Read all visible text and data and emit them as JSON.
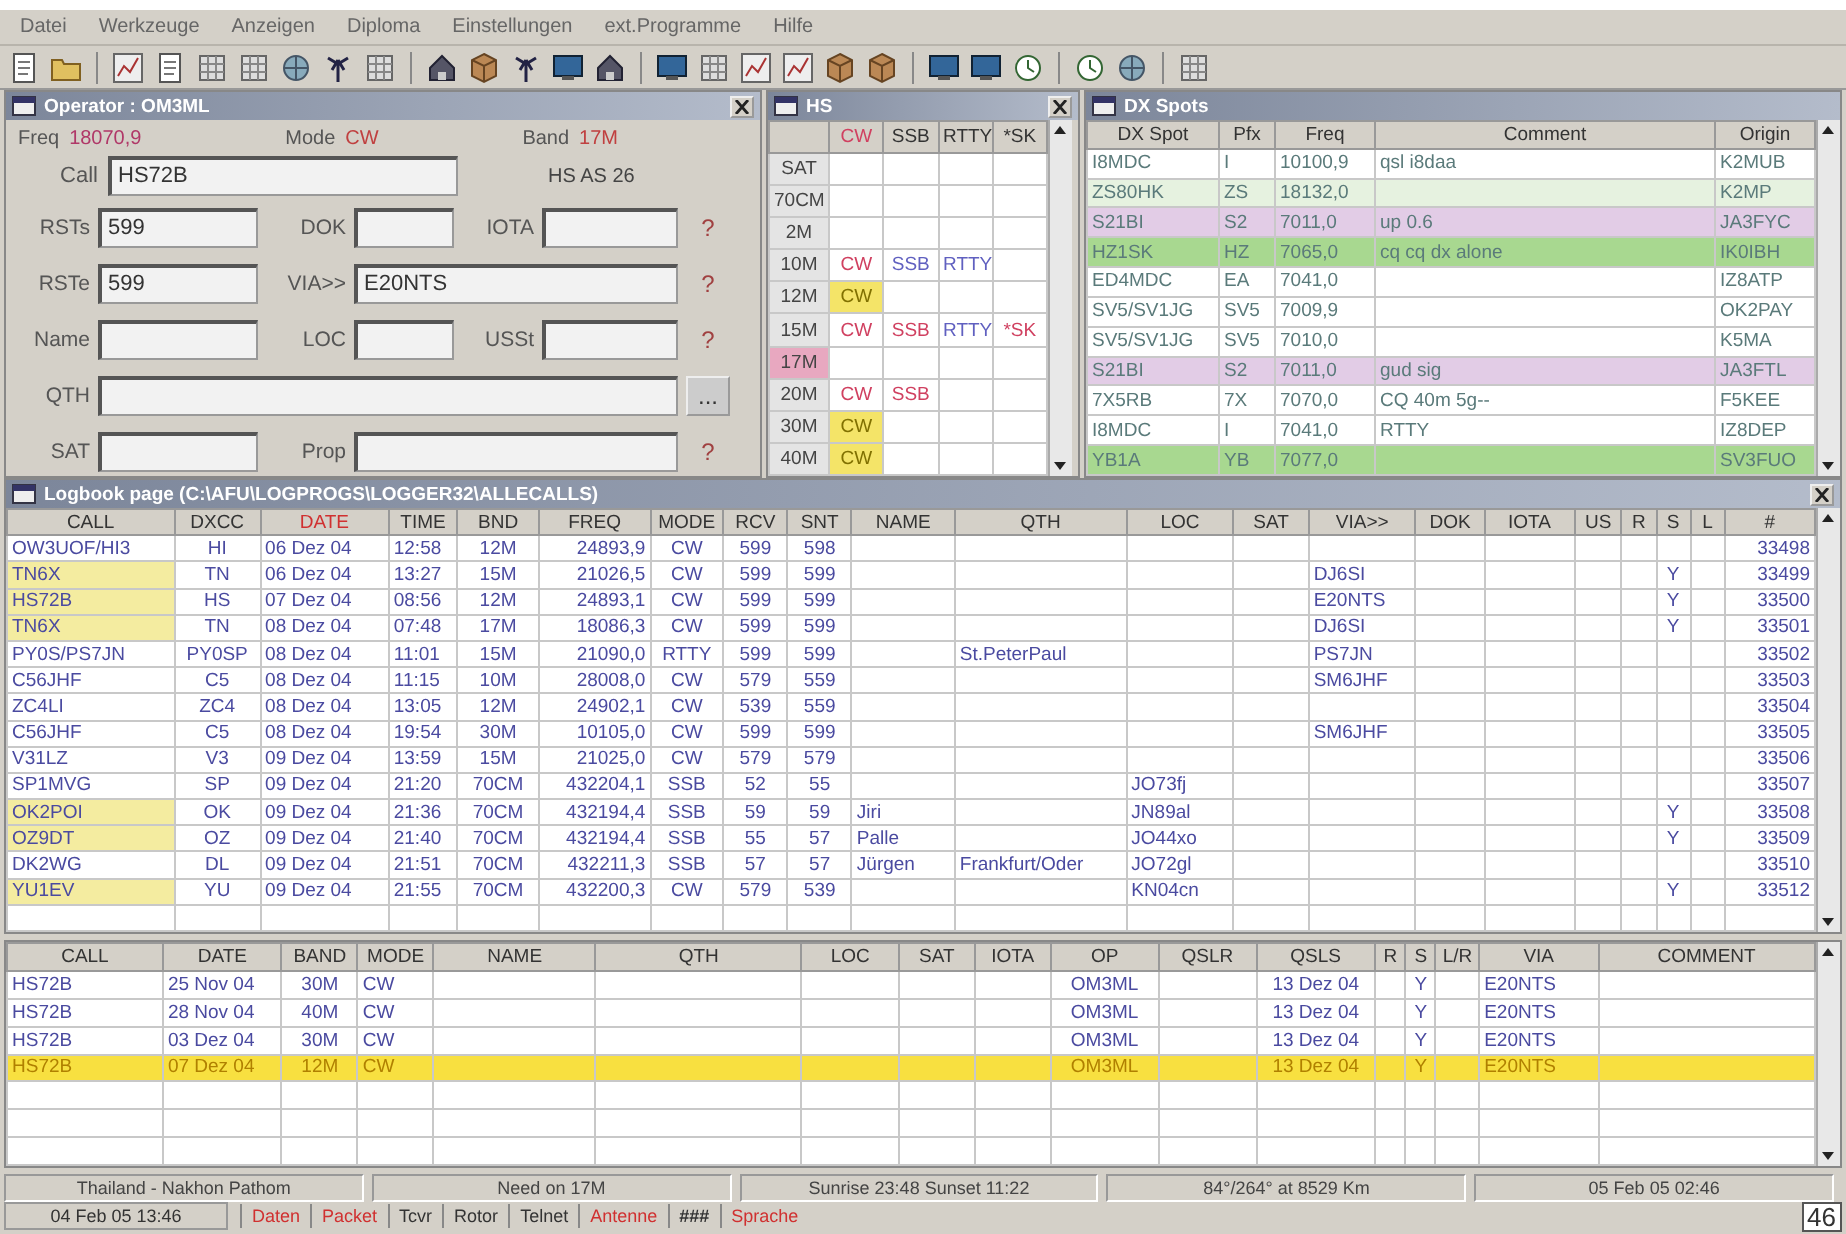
{
  "menu": [
    "Datei",
    "Werkzeuge",
    "Anzeigen",
    "Diploma",
    "Einstellungen",
    "ext.Programme",
    "Hilfe"
  ],
  "operator": {
    "title": "Operator : OM3ML",
    "freq_label": "Freq",
    "freq": "18070,9",
    "mode_label": "Mode",
    "mode": "CW",
    "band_label": "Band",
    "band": "17M",
    "call_label": "Call",
    "call": "HS72B",
    "prefix_info": "HS AS 26",
    "rows": [
      {
        "kind": "triple",
        "fields": [
          {
            "label": "RSTs",
            "value": "599"
          },
          {
            "label": "DOK"
          },
          {
            "label": "IOTA"
          }
        ],
        "button": "?"
      },
      {
        "kind": "double",
        "fields": [
          {
            "label": "RSTe",
            "value": "599"
          },
          {
            "label": "VIA>>",
            "value": "E20NTS"
          }
        ],
        "button": "?"
      },
      {
        "kind": "triple",
        "fields": [
          {
            "label": "Name"
          },
          {
            "label": "LOC"
          },
          {
            "label": "USSt"
          }
        ],
        "button": "?"
      },
      {
        "kind": "single",
        "fields": [
          {
            "label": "QTH"
          }
        ],
        "button": "..."
      },
      {
        "kind": "double",
        "fields": [
          {
            "label": "SAT"
          },
          {
            "label": "Prop"
          }
        ],
        "button": "?"
      }
    ]
  },
  "bands": {
    "title": "HS",
    "columns": [
      "CW",
      "SSB",
      "RTTY",
      "*SK"
    ],
    "rows": [
      {
        "band": "SAT",
        "selected": false,
        "cells": [
          null,
          null,
          null,
          null
        ]
      },
      {
        "band": "70CM",
        "selected": false,
        "cells": [
          null,
          null,
          null,
          null
        ]
      },
      {
        "band": "2M",
        "selected": false,
        "cells": [
          null,
          null,
          null,
          null
        ]
      },
      {
        "band": "10M",
        "selected": false,
        "cells": [
          {
            "text": "CW",
            "kind": "worked"
          },
          {
            "text": "SSB",
            "kind": "pending"
          },
          {
            "text": "RTTY",
            "kind": "pending"
          },
          null
        ]
      },
      {
        "band": "12M",
        "selected": false,
        "cells": [
          {
            "text": "CW",
            "kind": "confirmed"
          },
          null,
          null,
          null
        ]
      },
      {
        "band": "15M",
        "selected": false,
        "cells": [
          {
            "text": "CW",
            "kind": "worked"
          },
          {
            "text": "SSB",
            "kind": "worked"
          },
          {
            "text": "RTTY",
            "kind": "pending"
          },
          {
            "text": "*SK",
            "kind": "worked"
          }
        ]
      },
      {
        "band": "17M",
        "selected": true,
        "cells": [
          null,
          null,
          null,
          null
        ]
      },
      {
        "band": "20M",
        "selected": false,
        "cells": [
          {
            "text": "CW",
            "kind": "worked"
          },
          {
            "text": "SSB",
            "kind": "worked"
          },
          null,
          null
        ]
      },
      {
        "band": "30M",
        "selected": false,
        "cells": [
          {
            "text": "CW",
            "kind": "confirmed"
          },
          null,
          null,
          null
        ]
      },
      {
        "band": "40M",
        "selected": false,
        "cells": [
          {
            "text": "CW",
            "kind": "confirmed"
          },
          null,
          null,
          null
        ]
      }
    ]
  },
  "dx_spots": {
    "title": "DX Spots",
    "columns": [
      "DX Spot",
      "Pfx",
      "Freq",
      "Comment",
      "Origin"
    ],
    "rows": [
      {
        "color": "#ffffff",
        "cells": [
          "I8MDC",
          "I",
          "10100,9",
          "qsl i8daa",
          "K2MUB"
        ]
      },
      {
        "color": "#e6f2e0",
        "cells": [
          "ZS80HK",
          "ZS",
          "18132,0",
          null,
          "K2MP"
        ]
      },
      {
        "color": "#e2cce6",
        "cells": [
          "S21BI",
          "S2",
          "7011,0",
          "up 0.6",
          "JA3FYC"
        ]
      },
      {
        "color": "#a8d890",
        "cells": [
          "HZ1SK",
          "HZ",
          "7065,0",
          "cq cq dx alone",
          "IK0IBH"
        ]
      },
      {
        "color": "#ffffff",
        "cells": [
          "ED4MDC",
          "EA",
          "7041,0",
          null,
          "IZ8ATP"
        ]
      },
      {
        "color": "#ffffff",
        "cells": [
          "SV5/SV1JG",
          "SV5",
          "7009,9",
          null,
          "OK2PAY"
        ]
      },
      {
        "color": "#ffffff",
        "cells": [
          "SV5/SV1JG",
          "SV5",
          "7010,0",
          null,
          "K5MA"
        ]
      },
      {
        "color": "#e2cce6",
        "cells": [
          "S21BI",
          "S2",
          "7011,0",
          "gud sig",
          "JA3FTL"
        ]
      },
      {
        "color": "#ffffff",
        "cells": [
          "7X5RB",
          "7X",
          "7070,0",
          "CQ 40m 5g--",
          "F5KEE"
        ]
      },
      {
        "color": "#ffffff",
        "cells": [
          "I8MDC",
          "I",
          "7041,0",
          "RTTY",
          "IZ8DEP"
        ]
      },
      {
        "color": "#a8d890",
        "cells": [
          "YB1A",
          "YB",
          "7077,0",
          null,
          "SV3FUO"
        ]
      }
    ]
  },
  "logbook": {
    "title": "Logbook page (C:\\AFU\\LOGPROGS\\LOGGER32\\ALLECALLS)",
    "columns": [
      {
        "label": "CALL",
        "sorted": false
      },
      {
        "label": "DXCC",
        "sorted": false
      },
      {
        "label": "DATE",
        "sorted": true
      },
      {
        "label": "TIME",
        "sorted": false
      },
      {
        "label": "BND",
        "sorted": false
      },
      {
        "label": "FREQ",
        "sorted": false
      },
      {
        "label": "MODE",
        "sorted": false
      },
      {
        "label": "RCV",
        "sorted": false
      },
      {
        "label": "SNT",
        "sorted": false
      },
      {
        "label": "NAME",
        "sorted": false
      },
      {
        "label": "QTH",
        "sorted": false
      },
      {
        "label": "LOC",
        "sorted": false
      },
      {
        "label": "SAT",
        "sorted": false
      },
      {
        "label": "VIA>>",
        "sorted": false
      },
      {
        "label": "DOK",
        "sorted": false
      },
      {
        "label": "IOTA",
        "sorted": false
      },
      {
        "label": "US",
        "sorted": false
      },
      {
        "label": "R",
        "sorted": false
      },
      {
        "label": "S",
        "sorted": false
      },
      {
        "label": "L",
        "sorted": false
      },
      {
        "label": "#",
        "sorted": false
      }
    ],
    "rows": [
      {
        "highlighted": false,
        "cells": [
          "OW3UOF/HI3",
          "HI",
          "06 Dez 04",
          "12:58",
          "12M",
          "24893,9",
          "CW",
          "599",
          "598",
          null,
          null,
          null,
          null,
          null,
          null,
          null,
          null,
          null,
          null,
          null,
          "33498"
        ]
      },
      {
        "highlighted": true,
        "cells": [
          "TN6X",
          "TN",
          "06 Dez 04",
          "13:27",
          "15M",
          "21026,5",
          "CW",
          "599",
          "599",
          null,
          null,
          null,
          null,
          "DJ6SI",
          null,
          null,
          null,
          null,
          "Y",
          null,
          "33499"
        ]
      },
      {
        "highlighted": true,
        "cells": [
          "HS72B",
          "HS",
          "07 Dez 04",
          "08:56",
          "12M",
          "24893,1",
          "CW",
          "599",
          "599",
          null,
          null,
          null,
          null,
          "E20NTS",
          null,
          null,
          null,
          null,
          "Y",
          null,
          "33500"
        ]
      },
      {
        "highlighted": true,
        "cells": [
          "TN6X",
          "TN",
          "08 Dez 04",
          "07:48",
          "17M",
          "18086,3",
          "CW",
          "599",
          "599",
          null,
          null,
          null,
          null,
          "DJ6SI",
          null,
          null,
          null,
          null,
          "Y",
          null,
          "33501"
        ]
      },
      {
        "highlighted": false,
        "cells": [
          "PY0S/PS7JN",
          "PY0SP",
          "08 Dez 04",
          "11:01",
          "15M",
          "21090,0",
          "RTTY",
          "599",
          "599",
          null,
          "St.PeterPaul",
          null,
          null,
          "PS7JN",
          null,
          null,
          null,
          null,
          null,
          null,
          "33502"
        ]
      },
      {
        "highlighted": false,
        "cells": [
          "C56JHF",
          "C5",
          "08 Dez 04",
          "11:15",
          "10M",
          "28008,0",
          "CW",
          "579",
          "559",
          null,
          null,
          null,
          null,
          "SM6JHF",
          null,
          null,
          null,
          null,
          null,
          null,
          "33503"
        ]
      },
      {
        "highlighted": false,
        "cells": [
          "ZC4LI",
          "ZC4",
          "08 Dez 04",
          "13:05",
          "12M",
          "24902,1",
          "CW",
          "539",
          "559",
          null,
          null,
          null,
          null,
          null,
          null,
          null,
          null,
          null,
          null,
          null,
          "33504"
        ]
      },
      {
        "highlighted": false,
        "cells": [
          "C56JHF",
          "C5",
          "08 Dez 04",
          "19:54",
          "30M",
          "10105,0",
          "CW",
          "599",
          "599",
          null,
          null,
          null,
          null,
          "SM6JHF",
          null,
          null,
          null,
          null,
          null,
          null,
          "33505"
        ]
      },
      {
        "highlighted": false,
        "cells": [
          "V31LZ",
          "V3",
          "09 Dez 04",
          "13:59",
          "15M",
          "21025,0",
          "CW",
          "579",
          "579",
          null,
          null,
          null,
          null,
          null,
          null,
          null,
          null,
          null,
          null,
          null,
          "33506"
        ]
      },
      {
        "highlighted": false,
        "cells": [
          "SP1MVG",
          "SP",
          "09 Dez 04",
          "21:20",
          "70CM",
          "432204,1",
          "SSB",
          "52",
          "55",
          null,
          null,
          "JO73fj",
          null,
          null,
          null,
          null,
          null,
          null,
          null,
          null,
          "33507"
        ]
      },
      {
        "highlighted": true,
        "cells": [
          "OK2POI",
          "OK",
          "09 Dez 04",
          "21:36",
          "70CM",
          "432194,4",
          "SSB",
          "59",
          "59",
          "Jiri",
          null,
          "JN89al",
          null,
          null,
          null,
          null,
          null,
          null,
          "Y",
          null,
          "33508"
        ]
      },
      {
        "highlighted": true,
        "cells": [
          "OZ9DT",
          "OZ",
          "09 Dez 04",
          "21:40",
          "70CM",
          "432194,4",
          "SSB",
          "55",
          "57",
          "Palle",
          null,
          "JO44xo",
          null,
          null,
          null,
          null,
          null,
          null,
          "Y",
          null,
          "33509"
        ]
      },
      {
        "highlighted": false,
        "cells": [
          "DK2WG",
          "DL",
          "09 Dez 04",
          "21:51",
          "70CM",
          "432211,3",
          "SSB",
          "57",
          "57",
          "Jürgen",
          "Frankfurt/Oder",
          "JO72gl",
          null,
          null,
          null,
          null,
          null,
          null,
          null,
          null,
          "33510"
        ]
      },
      {
        "highlighted": true,
        "cells": [
          "YU1EV",
          "YU",
          "09 Dez 04",
          "21:55",
          "70CM",
          "432200,3",
          "CW",
          "579",
          "539",
          null,
          null,
          "KN04cn",
          null,
          null,
          null,
          null,
          null,
          null,
          "Y",
          null,
          "33512"
        ]
      }
    ]
  },
  "history": {
    "columns": [
      "CALL",
      "DATE",
      "BAND",
      "MODE",
      "NAME",
      "QTH",
      "LOC",
      "SAT",
      "IOTA",
      "OP",
      "QSLR",
      "QSLS",
      "R",
      "S",
      "L/R",
      "VIA",
      "COMMENT"
    ],
    "rows": [
      {
        "selected": false,
        "cells": [
          "HS72B",
          "25 Nov 04",
          "30M",
          "CW",
          null,
          null,
          null,
          null,
          null,
          "OM3ML",
          null,
          "13 Dez 04",
          null,
          "Y",
          null,
          "E20NTS",
          null
        ]
      },
      {
        "selected": false,
        "cells": [
          "HS72B",
          "28 Nov 04",
          "40M",
          "CW",
          null,
          null,
          null,
          null,
          null,
          "OM3ML",
          null,
          "13 Dez 04",
          null,
          "Y",
          null,
          "E20NTS",
          null
        ]
      },
      {
        "selected": false,
        "cells": [
          "HS72B",
          "03 Dez 04",
          "30M",
          "CW",
          null,
          null,
          null,
          null,
          null,
          "OM3ML",
          null,
          "13 Dez 04",
          null,
          "Y",
          null,
          "E20NTS",
          null
        ]
      },
      {
        "selected": true,
        "cells": [
          "HS72B",
          "07 Dez 04",
          "12M",
          "CW",
          null,
          null,
          null,
          null,
          null,
          "OM3ML",
          null,
          "13 Dez 04",
          null,
          "Y",
          null,
          "E20NTS",
          null
        ]
      }
    ]
  },
  "status_bar": {
    "fields": [
      "Thailand - Nakhon Pathom",
      "Need on 17M",
      "Sunrise 23:48 Sunset 11:22",
      "84°/264° at 8529 Km",
      "05 Feb 05 02:46"
    ],
    "date": "04 Feb 05 13:46",
    "buttons": [
      {
        "label": "Daten",
        "on": true
      },
      {
        "label": "Packet",
        "on": true
      },
      {
        "label": "Tcvr",
        "on": false
      },
      {
        "label": "Rotor",
        "on": false
      },
      {
        "label": "Telnet",
        "on": false
      },
      {
        "label": "Antenne",
        "on": true
      },
      {
        "label": "###",
        "on": false
      },
      {
        "label": "Sprache",
        "on": true
      }
    ],
    "clock": "46"
  }
}
